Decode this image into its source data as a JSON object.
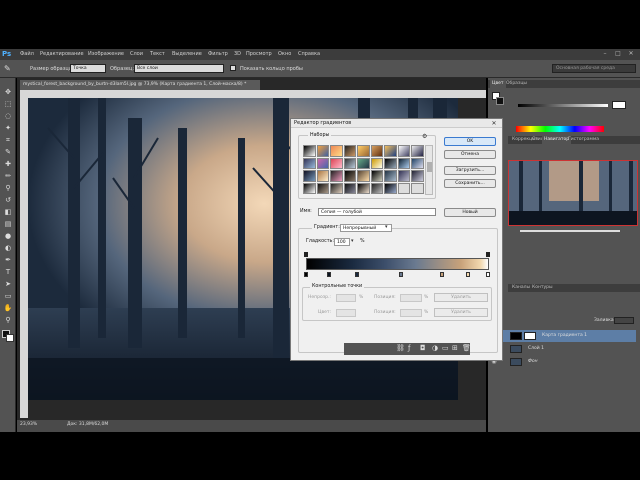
{
  "app": {
    "logo": "Ps",
    "menu": [
      "Файл",
      "Редактирование",
      "Изображение",
      "Слои",
      "Текст",
      "Выделение",
      "Фильтр",
      "3D",
      "Просмотр",
      "Окно",
      "Справка"
    ],
    "window_controls": [
      "–",
      "□",
      "✕"
    ]
  },
  "options_bar": {
    "sample_size_label": "Размер образца:",
    "sample_size_value": "Точка",
    "sample_label": "Образец:",
    "sample_value": "Все слои",
    "show_ring_label": "Показать кольцо пробы",
    "search_placeholder": "Основная рабочая среда"
  },
  "document": {
    "tab_title": "mystical_forest_background_by_burtn-d3lam5l.jpg @ 73,9% (Карта градиента 1, Слой-маска/8) *",
    "zoom": "23,93%",
    "doc_size": "Док: 31,8M/62,0M"
  },
  "right_panel": {
    "color_tabs": [
      "Цвет",
      "Образцы"
    ],
    "adjust_tabs": [
      "Коррекция",
      "Стили",
      "Навигатор",
      "Гистограмма"
    ],
    "layers_tabs": [
      "Каналы",
      "Контуры"
    ],
    "fill_label": "Заливка:",
    "layers": [
      {
        "name": "Карта градиента 1",
        "selected": true
      },
      {
        "name": "Слой 1",
        "selected": false
      },
      {
        "name": "Фон",
        "selected": false
      }
    ]
  },
  "dialog": {
    "title": "Редактор градиентов",
    "presets_label": "Наборы",
    "ok": "OK",
    "cancel": "Отмена",
    "load": "Загрузить...",
    "save": "Сохранить...",
    "name_label": "Имя:",
    "name_value": "Сепия — голубой",
    "new_button": "Новый",
    "gradient_type_label": "Градиент:",
    "gradient_type_value": "Непрерывный",
    "smoothness_label": "Гладкость:",
    "smoothness_value": "100",
    "smoothness_unit": "%",
    "stops_label": "Контрольные точки",
    "opacity_label": "Непрозр.:",
    "color_label": "Цвет:",
    "position_label": "Позиция:",
    "percent": "%",
    "delete_label": "Удалить"
  },
  "colors": {
    "accent": "#3a7ad0",
    "panel_bg": "#535353",
    "dialog_bg": "#f0f0f0"
  }
}
